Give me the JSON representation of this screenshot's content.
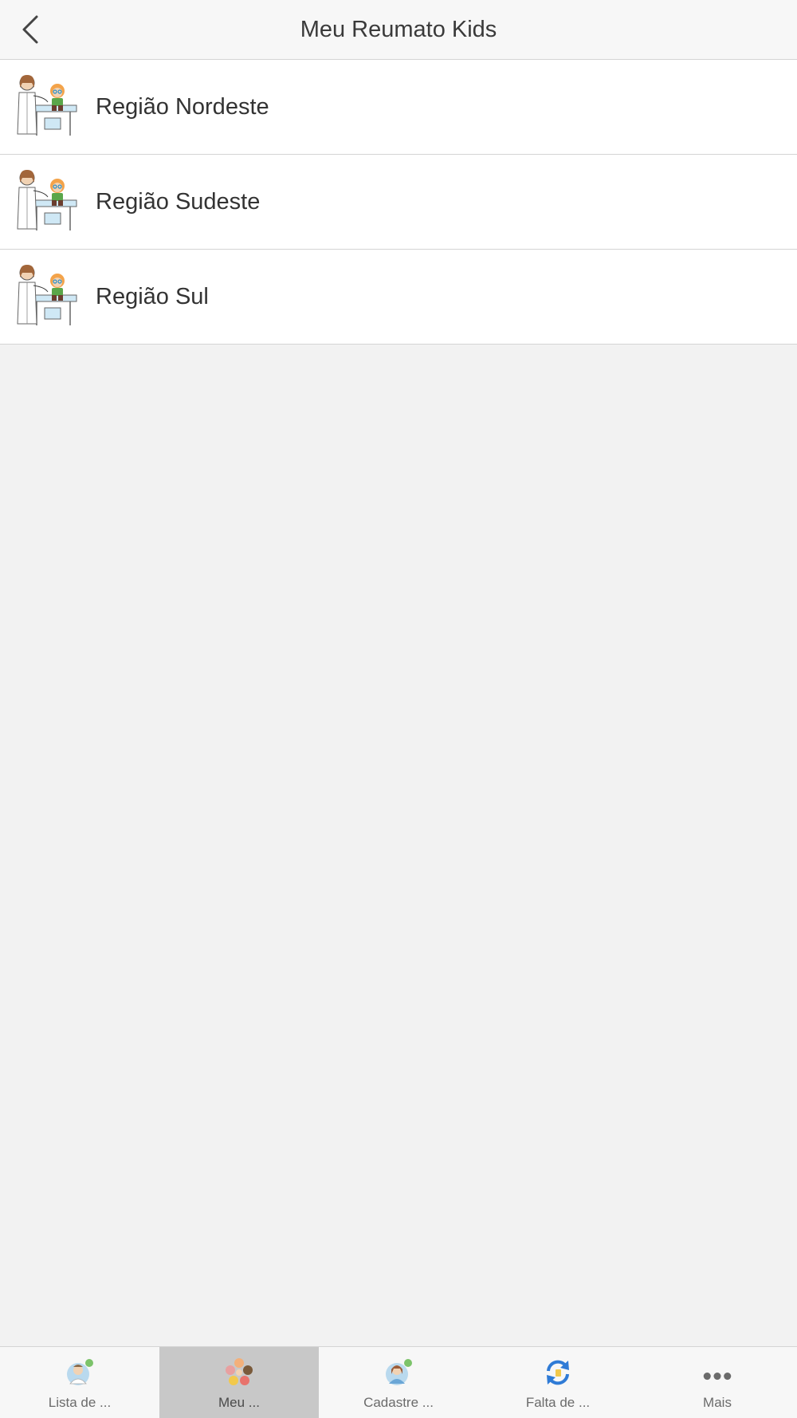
{
  "header": {
    "title": "Meu Reumato Kids",
    "back_icon": "chevron-left-icon"
  },
  "regions": [
    {
      "label": "Região Nordeste",
      "icon": "doctor-child-illustration"
    },
    {
      "label": "Região Sudeste",
      "icon": "doctor-child-illustration"
    },
    {
      "label": "Região Sul",
      "icon": "doctor-child-illustration"
    }
  ],
  "tabbar": {
    "active_index": 1,
    "tabs": [
      {
        "label": "Lista de ...",
        "icon": "doctor-list-icon"
      },
      {
        "label": "Meu ...",
        "icon": "kids-group-icon"
      },
      {
        "label": "Cadastre ...",
        "icon": "register-icon"
      },
      {
        "label": "Falta de ...",
        "icon": "refresh-arrows-icon"
      },
      {
        "label": "Mais",
        "icon": "more-dots-icon"
      }
    ]
  },
  "colors": {
    "background": "#f2f2f2",
    "active_tab": "#c8c8c8",
    "refresh_blue": "#2f7bd6"
  }
}
